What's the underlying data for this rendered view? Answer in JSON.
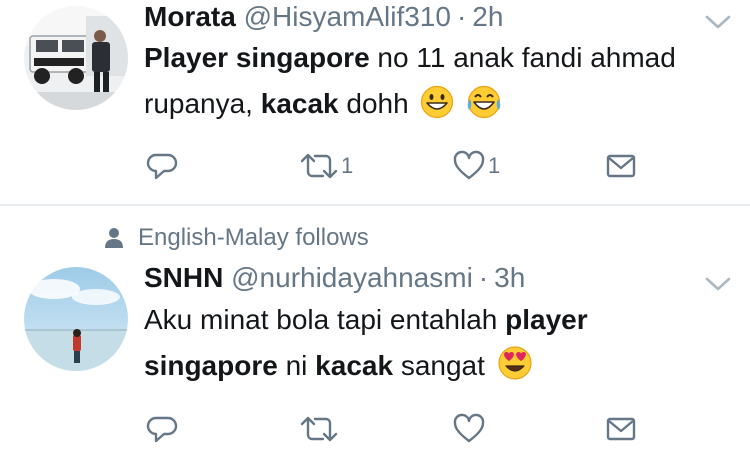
{
  "tweets": [
    {
      "name": "Morata",
      "handle": "@HisyamAlif310",
      "separator": "·",
      "time": "2h",
      "text": [
        {
          "t": "Player singapore",
          "bold": true
        },
        {
          "t": " no 11 anak fandi ahmad rupanya, ",
          "bold": false
        },
        {
          "t": "kacak",
          "bold": true
        },
        {
          "t": " dohh",
          "bold": false
        }
      ],
      "emojis": [
        "grinning-face",
        "face-with-tears-of-joy"
      ],
      "actions": {
        "reply_count": "",
        "retweet_count": "1",
        "like_count": "1"
      }
    },
    {
      "context": "English-Malay follows",
      "name": "SNHN",
      "handle": "@nurhidayahnasmi",
      "separator": "·",
      "time": "3h",
      "text": [
        {
          "t": "Aku minat bola tapi entahlah ",
          "bold": false
        },
        {
          "t": "player singapore",
          "bold": true
        },
        {
          "t": " ni ",
          "bold": false
        },
        {
          "t": "kacak",
          "bold": true
        },
        {
          "t": " sangat",
          "bold": false
        }
      ],
      "emojis": [
        "smiling-face-with-heart-eyes"
      ],
      "actions": {
        "reply_count": "",
        "retweet_count": "",
        "like_count": ""
      }
    }
  ],
  "icon_color": "#657786"
}
